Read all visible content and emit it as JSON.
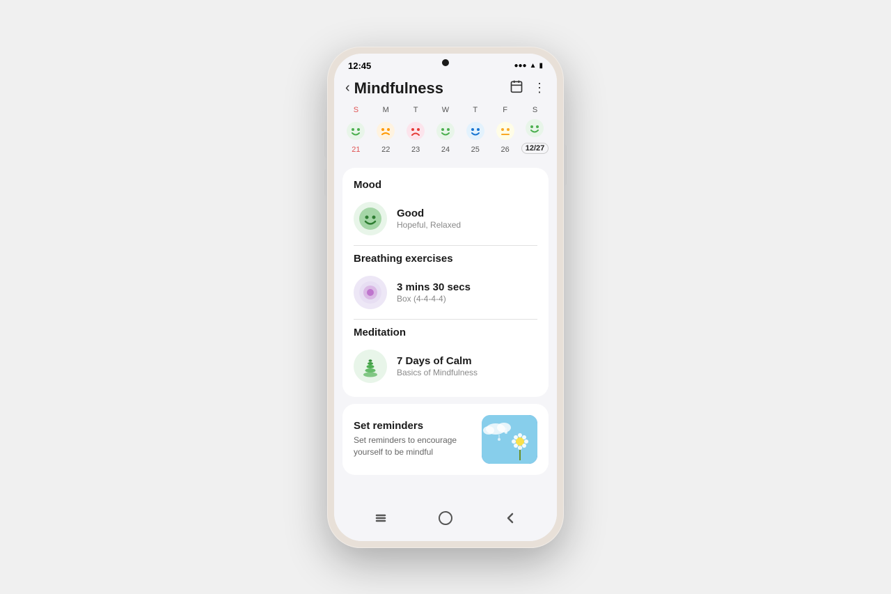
{
  "phone": {
    "status_time": "12:45",
    "camera": true
  },
  "header": {
    "back_label": "‹",
    "title": "Mindfulness",
    "calendar_icon": "📅",
    "more_icon": "⋮"
  },
  "calendar": {
    "day_labels": [
      "S",
      "M",
      "T",
      "W",
      "T",
      "F",
      "S"
    ],
    "day_types": [
      "sun",
      "weekday",
      "weekday",
      "weekday",
      "weekday",
      "weekday",
      "weekday"
    ],
    "days": [
      {
        "num": "21",
        "face_color": "green",
        "mood": "happy",
        "selected": false,
        "is_sun": true
      },
      {
        "num": "22",
        "face_color": "orange",
        "mood": "neutral",
        "selected": false,
        "is_sun": false
      },
      {
        "num": "23",
        "face_color": "red-orange",
        "mood": "sad",
        "selected": false,
        "is_sun": false
      },
      {
        "num": "24",
        "face_color": "green",
        "mood": "happy",
        "selected": false,
        "is_sun": false
      },
      {
        "num": "25",
        "face_color": "blue",
        "mood": "happy",
        "selected": false,
        "is_sun": false
      },
      {
        "num": "26",
        "face_color": "yellow",
        "mood": "neutral",
        "selected": false,
        "is_sun": false
      },
      {
        "num": "12/27",
        "face_color": "green",
        "mood": "happy",
        "selected": true,
        "is_sun": false
      }
    ]
  },
  "mood_section": {
    "title": "Mood",
    "mood_value": "Good",
    "mood_sub": "Hopeful, Relaxed"
  },
  "breathing_section": {
    "title": "Breathing exercises",
    "duration": "3 mins 30 secs",
    "type": "Box (4-4-4-4)"
  },
  "meditation_section": {
    "title": "Meditation",
    "program": "7 Days of Calm",
    "sub": "Basics of Mindfulness"
  },
  "reminders_section": {
    "title": "Set reminders",
    "description": "Set reminders to encourage yourself to be mindful"
  },
  "bottom_nav": {
    "recent_icon": "|||",
    "home_icon": "○",
    "back_icon": "<"
  }
}
